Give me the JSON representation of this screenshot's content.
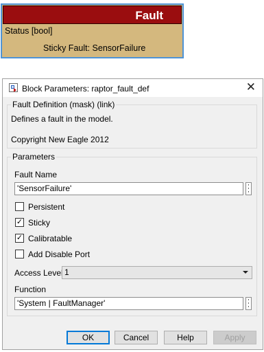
{
  "block": {
    "title": "Fault",
    "port_label": "Status  [bool]",
    "sticky_label": "Sticky Fault: SensorFailure"
  },
  "dialog": {
    "title": "Block Parameters: raptor_fault_def",
    "mask_group": {
      "legend": "Fault Definition (mask) (link)",
      "description": "Defines a fault in the model.",
      "copyright": "Copyright New Eagle 2012"
    },
    "params": {
      "legend": "Parameters",
      "fault_name_label": "Fault Name",
      "fault_name_value": "'SensorFailure'",
      "checkboxes": [
        {
          "label": "Persistent",
          "checked": false
        },
        {
          "label": "Sticky",
          "checked": true
        },
        {
          "label": "Calibratable",
          "checked": true
        },
        {
          "label": "Add Disable Port",
          "checked": false
        }
      ],
      "access_level_label": "Access Level",
      "access_level_value": "1",
      "function_label": "Function",
      "function_value": "'System | FaultManager'"
    },
    "buttons": {
      "ok": "OK",
      "cancel": "Cancel",
      "help": "Help",
      "apply": "Apply"
    }
  }
}
